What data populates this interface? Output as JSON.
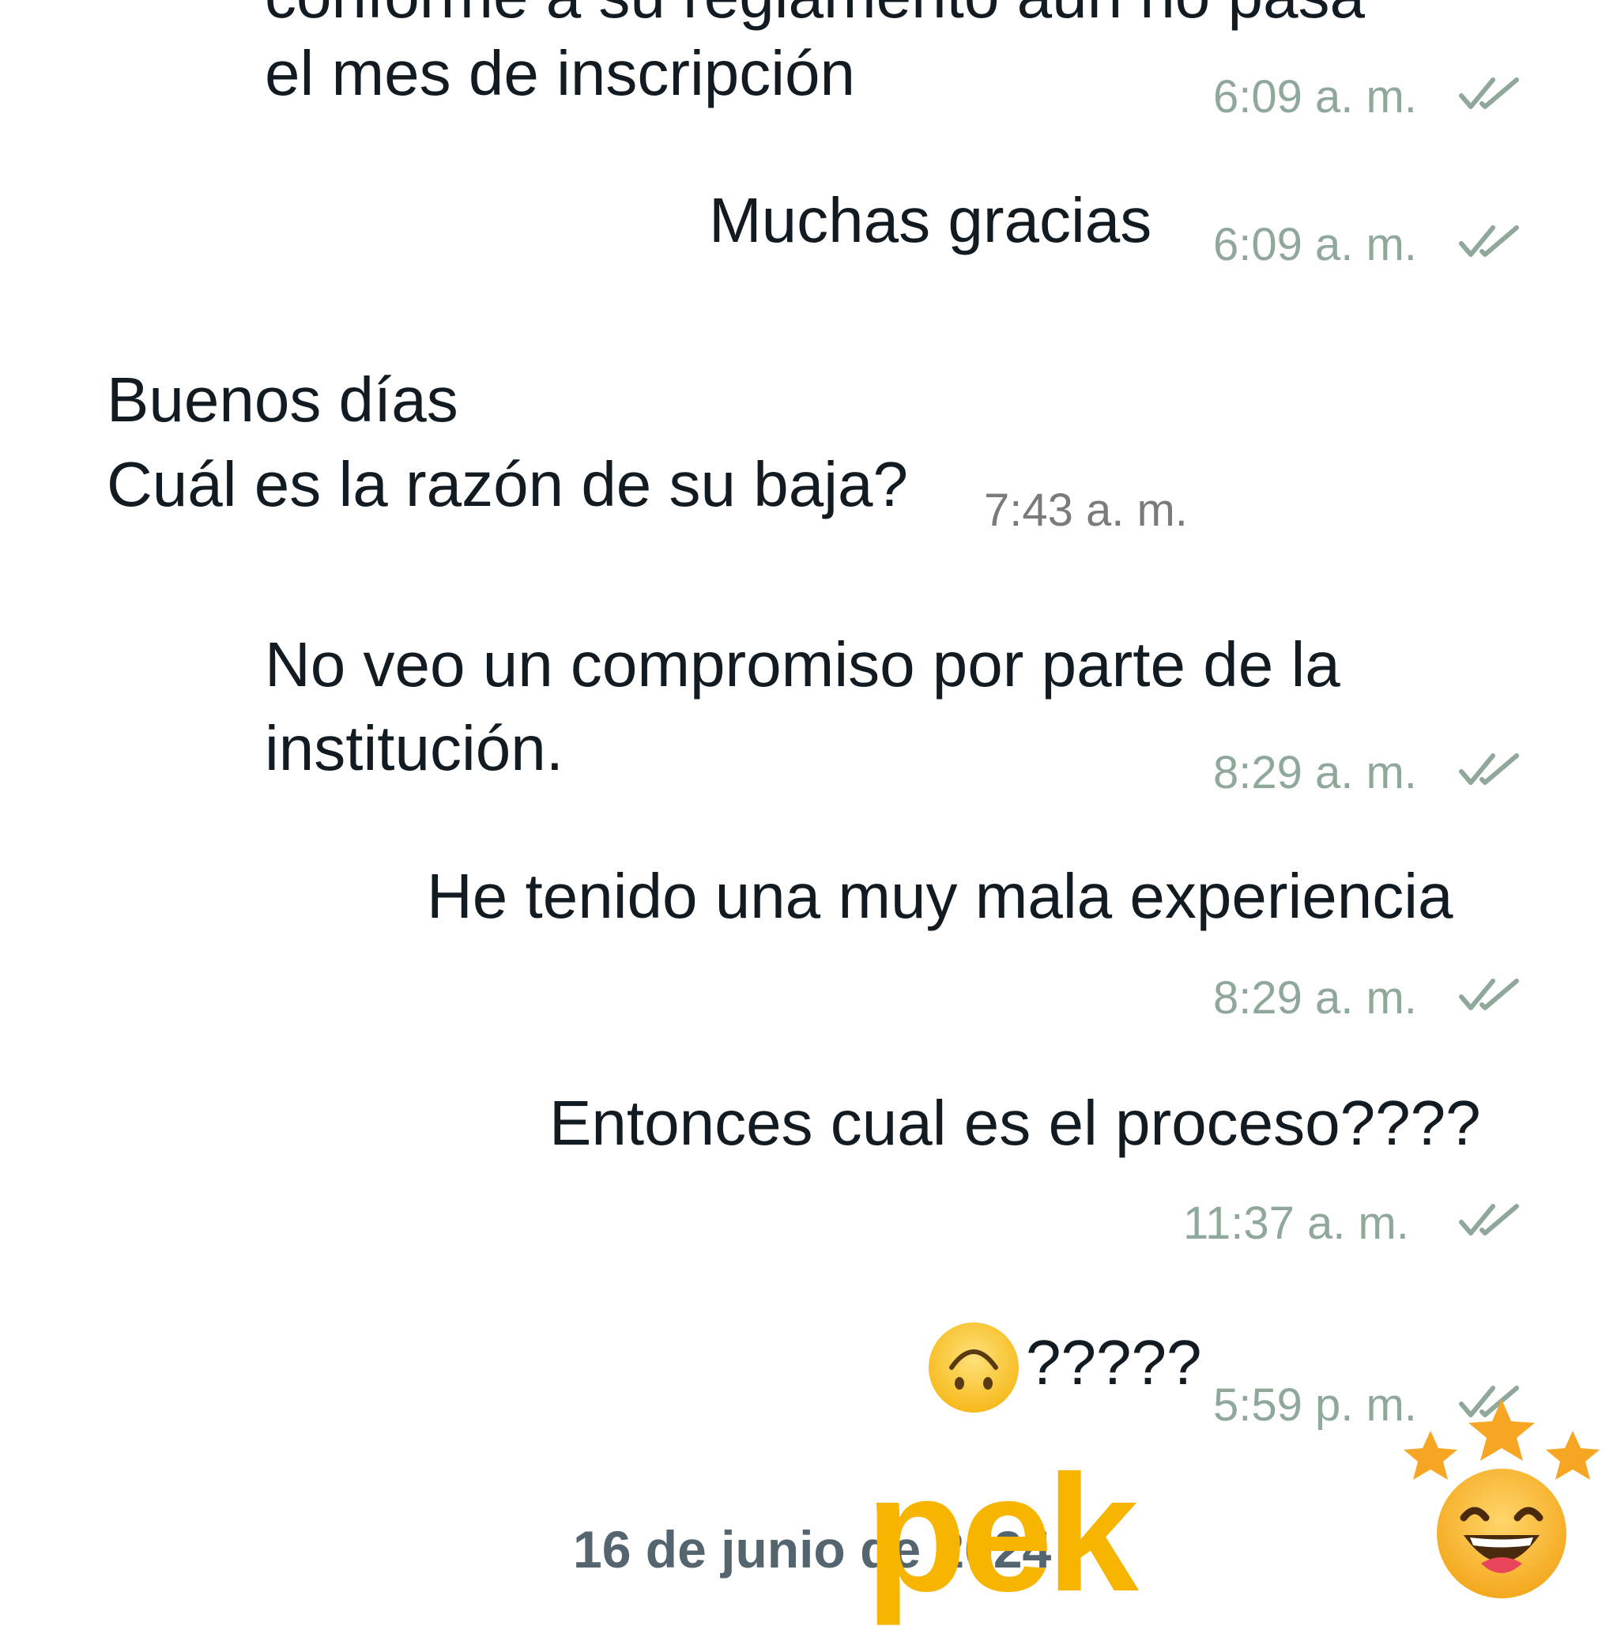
{
  "messages": [
    {
      "text": "conforme a su reglamento aun no pasa",
      "direction": "out"
    },
    {
      "text": "el mes de inscripción",
      "time": "6:09 a. m.",
      "direction": "out",
      "status": "read-double-check"
    },
    {
      "text": "Muchas gracias",
      "time": "6:09 a. m.",
      "direction": "out",
      "status": "read-double-check"
    },
    {
      "line1": "Buenos días",
      "line2": "Cuál es la razón de su baja?",
      "time": "7:43 a. m.",
      "direction": "in"
    },
    {
      "line1": "No veo un compromiso por parte de la",
      "line2": "institución.",
      "time": "8:29 a. m.",
      "direction": "out",
      "status": "read-double-check"
    },
    {
      "text": "He tenido una muy mala experiencia",
      "time": "8:29 a. m.",
      "direction": "out",
      "status": "read-double-check"
    },
    {
      "text": "Entonces cual es el proceso????",
      "time": "11:37 a. m.",
      "direction": "out",
      "status": "read-double-check"
    },
    {
      "text": "?????",
      "emoji": "upside-down-face",
      "time": "5:59 p. m.",
      "direction": "out",
      "status": "read-double-check"
    }
  ],
  "date_separator": "16 de junio de 2024",
  "watermark": {
    "text": "pek",
    "icon": "laughing-face-with-stars",
    "color": "#f7b500"
  },
  "colors": {
    "timestamp_out": "#8fa89a",
    "timestamp_in": "#7b7b7b",
    "text": "#111b21",
    "date": "#54656f"
  }
}
